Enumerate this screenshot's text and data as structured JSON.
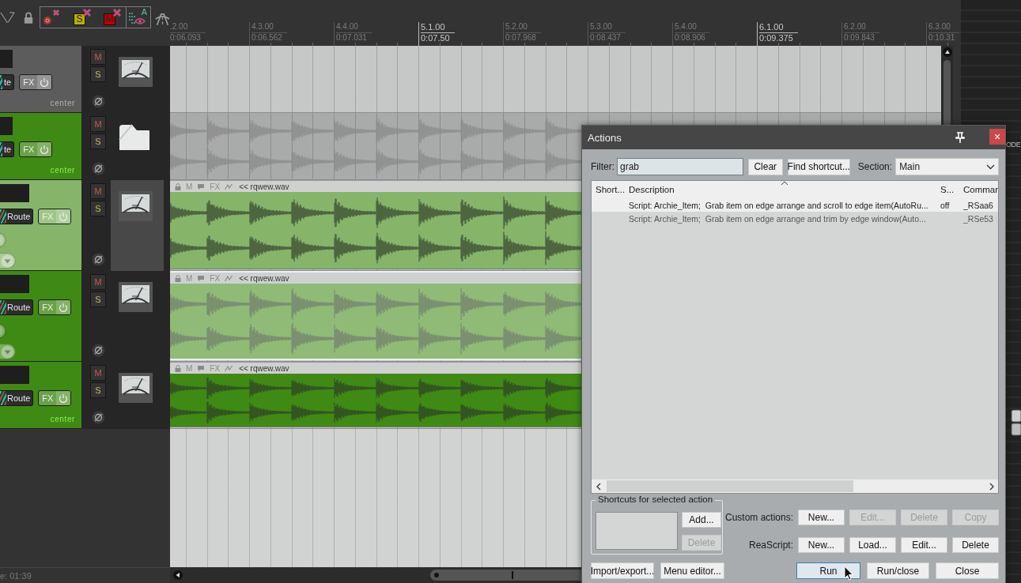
{
  "toolbar": {
    "solo_clear_label": "S",
    "mute_clear_label": "M",
    "visibility_label": "A"
  },
  "ruler": {
    "marks": [
      {
        "bar": ".2.00",
        "time": "0:06.093",
        "major": false
      },
      {
        "bar": "4.3.00",
        "time": "0:06.562",
        "major": false
      },
      {
        "bar": "4.4.00",
        "time": "0:07.031",
        "major": false
      },
      {
        "bar": "5.1.00",
        "time": "0:07.50",
        "major": true
      },
      {
        "bar": "5.2.00",
        "time": "0:07.968",
        "major": false
      },
      {
        "bar": "5.3.00",
        "time": "0:08.437",
        "major": false
      },
      {
        "bar": "5.4.00",
        "time": "0:08.906",
        "major": false
      },
      {
        "bar": "6.1.00",
        "time": "0:09.375",
        "major": true
      },
      {
        "bar": "6.2.00",
        "time": "0:09.843",
        "major": false
      },
      {
        "bar": "6.3.00",
        "time": "0:10.31",
        "major": false
      }
    ]
  },
  "tracks": [
    {
      "kind": "empty",
      "color": "#5c5c5c",
      "selected": false,
      "route_label": "te",
      "fx_label": "FX",
      "pan_label": "center",
      "mute_label": "M",
      "solo_label": "S"
    },
    {
      "kind": "folder",
      "color": "#3f8a14",
      "selected": false,
      "route_label": "te",
      "fx_label": "FX",
      "pan_label": "center",
      "mute_label": "M",
      "solo_label": "S"
    },
    {
      "kind": "tallclip",
      "color": "#86b56a",
      "selected": true,
      "route_label": "Route",
      "fx_label": "FX",
      "mute_label": "M",
      "solo_label": "S",
      "item": {
        "mute_label": "M",
        "fx_label": "FX",
        "name": "<< rqwew.wav",
        "selected": false
      }
    },
    {
      "kind": "tallclip",
      "color": "#3f8a14",
      "selected": false,
      "route_label": "Route",
      "fx_label": "FX",
      "mute_label": "M",
      "solo_label": "S",
      "item": {
        "mute_label": "M",
        "fx_label": "FX",
        "name": "<< rqwew.wav",
        "selected": true
      }
    },
    {
      "kind": "clip",
      "color": "#3f8a14",
      "selected": false,
      "route_label": "Route",
      "fx_label": "FX",
      "pan_label": "center",
      "mute_label": "M",
      "solo_label": "S",
      "item": {
        "mute_label": "M",
        "fx_label": "FX",
        "name": "<< rqwew.wav",
        "selected": false
      }
    }
  ],
  "status": {
    "text": "e: 01:39"
  },
  "mixer": {
    "label": "ODE"
  },
  "actions_dialog": {
    "title": "Actions",
    "close_glyph": "×",
    "filter_label": "Filter:",
    "filter_value": "grab",
    "top_buttons": [
      {
        "label": "Clear"
      },
      {
        "label": "Find shortcut..."
      }
    ],
    "section_label": "Section:",
    "section_value": "Main",
    "columns": [
      "Short...",
      "Description",
      "S...",
      "Commar"
    ],
    "rows": [
      {
        "description": "Script: Archie_Item;  Grab item on edge arrange and scroll to edge item(AutoRu...",
        "state": "off",
        "command": "_RSaa6",
        "selected": true
      },
      {
        "description": "Script: Archie_Item;  Grab item on edge arrange and trim by edge window(Auto...",
        "command": "_RSe53",
        "selected": false
      }
    ],
    "shortcuts_group": {
      "title": "Shortcuts for selected action",
      "buttons": [
        {
          "label": "Add...",
          "disabled": false
        },
        {
          "label": "Delete",
          "disabled": true
        }
      ]
    },
    "custom_actions": {
      "label": "Custom actions:",
      "buttons": [
        {
          "label": "New...",
          "disabled": false
        },
        {
          "label": "Edit...",
          "disabled": true
        },
        {
          "label": "Delete",
          "disabled": true
        },
        {
          "label": "Copy",
          "disabled": true
        }
      ]
    },
    "reascript": {
      "label": "ReaScript:",
      "buttons": [
        {
          "label": "New...",
          "disabled": false
        },
        {
          "label": "Load...",
          "disabled": false
        },
        {
          "label": "Edit...",
          "disabled": false
        },
        {
          "label": "Delete",
          "disabled": false
        }
      ]
    },
    "footer_left": [
      {
        "label": "Import/export..."
      },
      {
        "label": "Menu editor..."
      }
    ],
    "footer_right": [
      {
        "label": "Run",
        "focused": true
      },
      {
        "label": "Run/close",
        "focused": false
      },
      {
        "label": "Close",
        "focused": false
      }
    ]
  }
}
